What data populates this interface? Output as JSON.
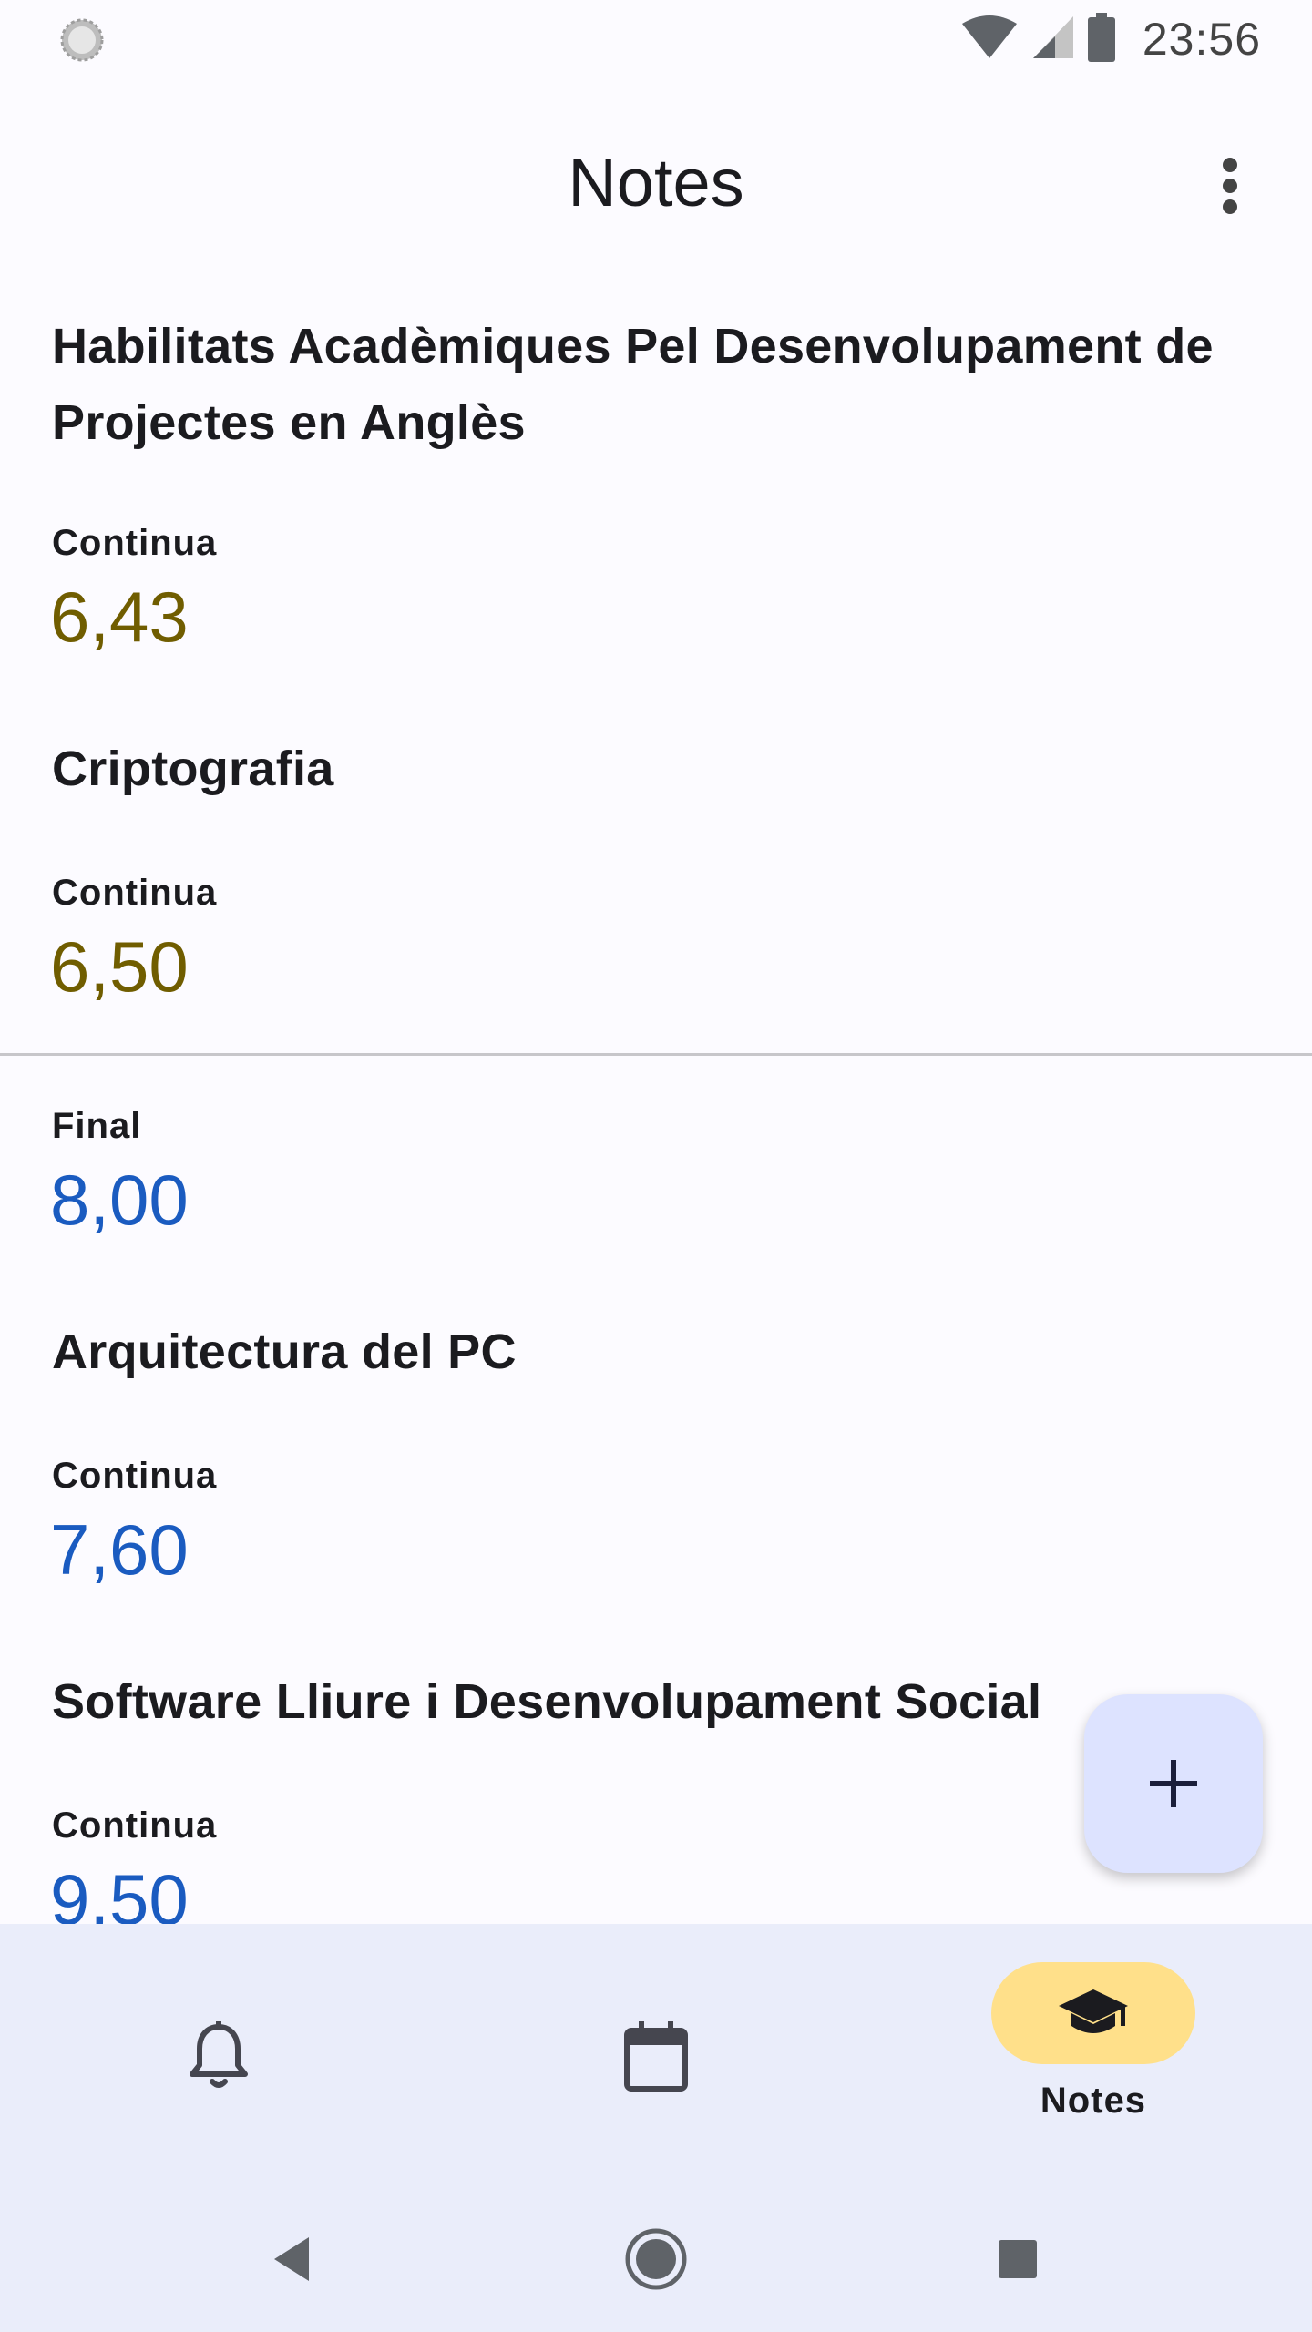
{
  "status_bar": {
    "time": "23:56"
  },
  "app_bar": {
    "title": "Notes"
  },
  "subjects": [
    {
      "title": "Habilitats Acadèmiques Pel Desenvolupament de Projectes en Anglès",
      "grades": [
        {
          "label": "Continua",
          "value": "6,43",
          "color": "#705d00"
        }
      ]
    },
    {
      "title": "Criptografia",
      "grades": [
        {
          "label": "Continua",
          "value": "6,50",
          "color": "#705d00"
        },
        {
          "label": "Final",
          "value": "8,00",
          "color": "#1a5bc0"
        }
      ]
    },
    {
      "title": "Arquitectura del PC",
      "grades": [
        {
          "label": "Continua",
          "value": "7,60",
          "color": "#1a5bc0"
        }
      ]
    },
    {
      "title": "Software Lliure i Desenvolupament Social",
      "grades": [
        {
          "label": "Continua",
          "value": "9,50",
          "color": "#1a5bc0"
        }
      ]
    }
  ],
  "fab": {
    "icon": "plus-icon"
  },
  "bottom_nav": {
    "items": [
      {
        "icon": "bell-icon",
        "label": ""
      },
      {
        "icon": "calendar-icon",
        "label": ""
      },
      {
        "icon": "graduation-cap-icon",
        "label": "Notes",
        "selected": true
      }
    ]
  },
  "colors": {
    "background": "#fcfbff",
    "nav_background": "#eaedfa",
    "selected_pill": "#ffe08a",
    "fab": "#dde3ff",
    "grade_gold": "#705d00",
    "grade_blue": "#1a5bc0"
  }
}
